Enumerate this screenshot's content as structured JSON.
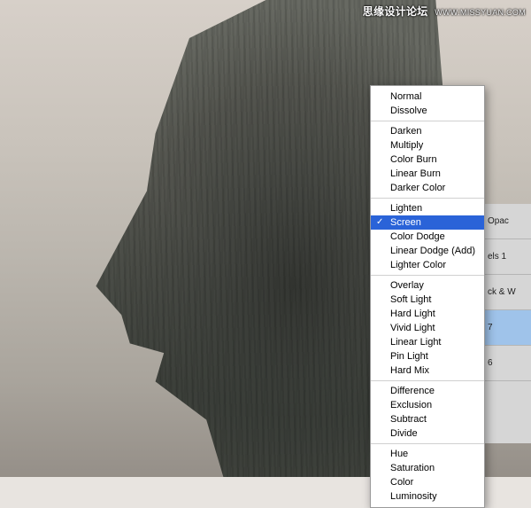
{
  "watermark": {
    "main": "思缘设计论坛",
    "sub": "WWW.MISSYUAN.COM"
  },
  "panel": {
    "opacity_label": "Opac",
    "layers": [
      {
        "label": "els 1"
      },
      {
        "label": "ck & W"
      },
      {
        "label": "7",
        "selected": true
      },
      {
        "label": "6"
      }
    ]
  },
  "blend_menu": {
    "selected": "Screen",
    "groups": [
      [
        "Normal",
        "Dissolve"
      ],
      [
        "Darken",
        "Multiply",
        "Color Burn",
        "Linear Burn",
        "Darker Color"
      ],
      [
        "Lighten",
        "Screen",
        "Color Dodge",
        "Linear Dodge (Add)",
        "Lighter Color"
      ],
      [
        "Overlay",
        "Soft Light",
        "Hard Light",
        "Vivid Light",
        "Linear Light",
        "Pin Light",
        "Hard Mix"
      ],
      [
        "Difference",
        "Exclusion",
        "Subtract",
        "Divide"
      ],
      [
        "Hue",
        "Saturation",
        "Color",
        "Luminosity"
      ]
    ]
  }
}
